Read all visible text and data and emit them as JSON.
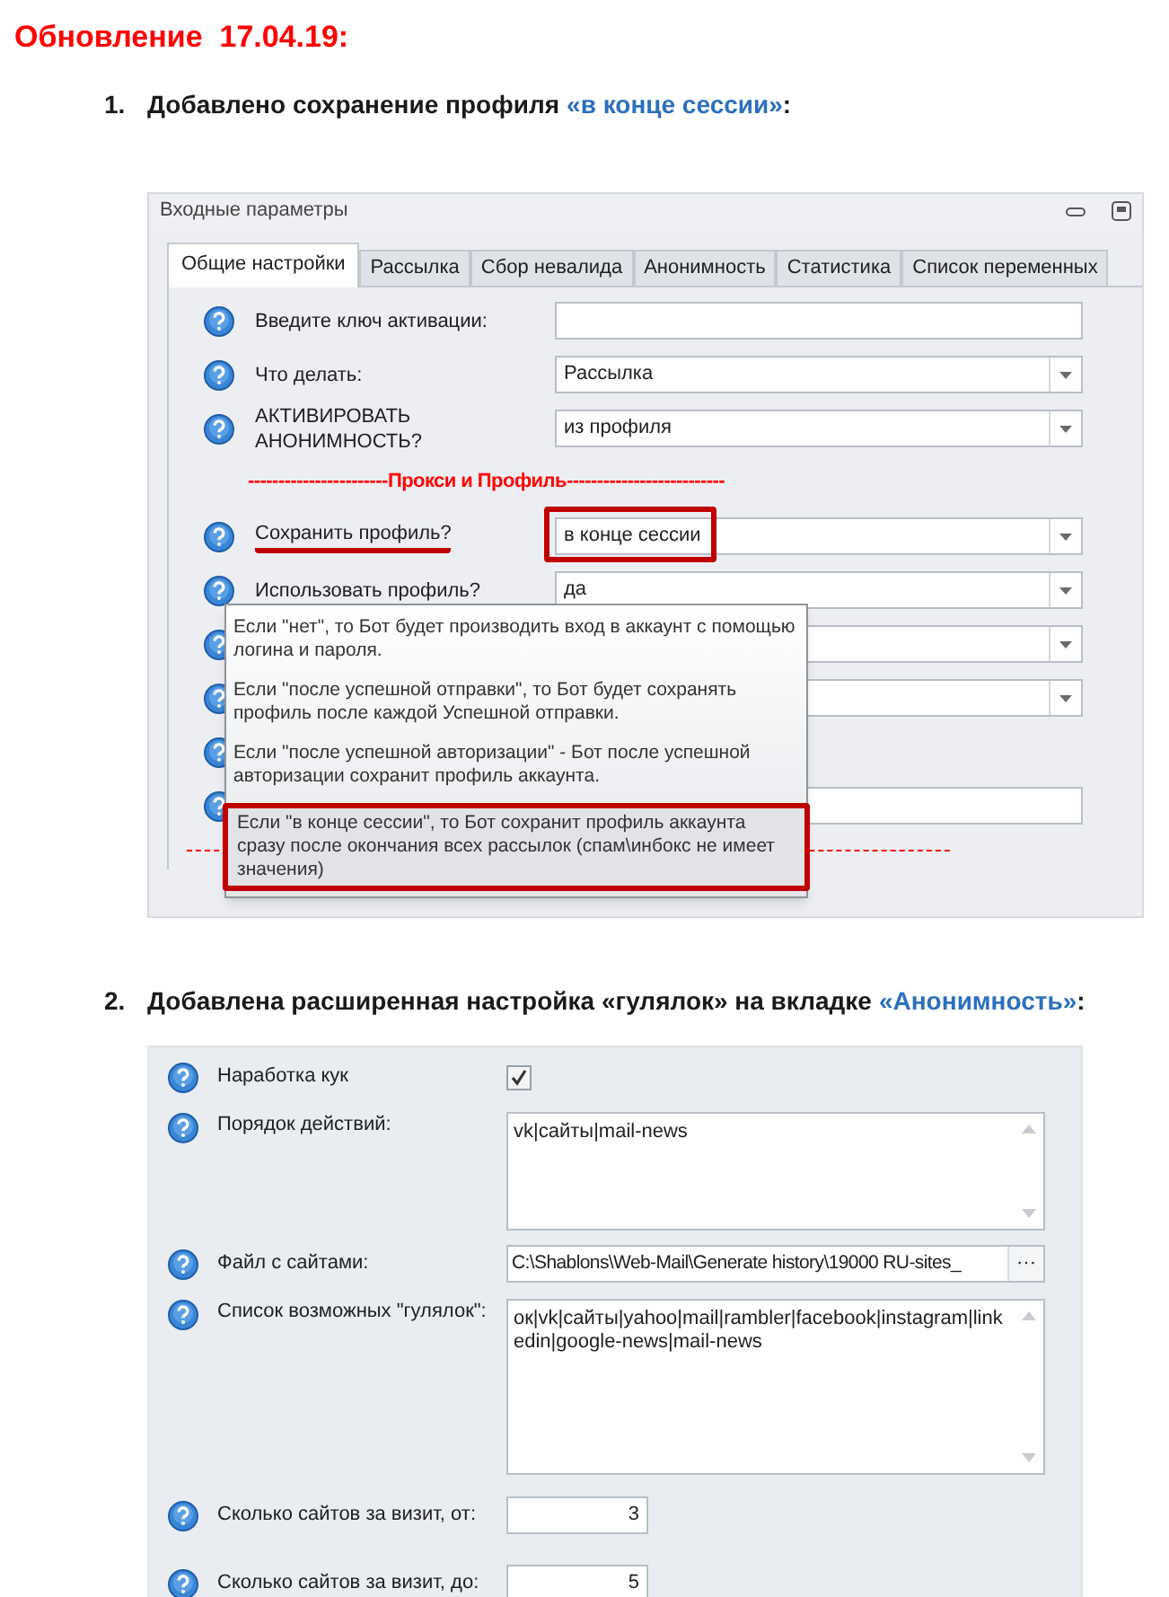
{
  "heading": "Обновление  17.04.19:",
  "items": [
    {
      "number": "1.",
      "text": "Добавлено сохранение профиля",
      "highlight": "«в конце сессии»",
      "suffix": ":",
      "panel": {
        "title": "Входные параметры",
        "tabs": [
          {
            "label": "Общие настройки",
            "selected": true
          },
          {
            "label": "Рассылка",
            "selected": false
          },
          {
            "label": "Сбор невалида",
            "selected": false
          },
          {
            "label": "Анонимность",
            "selected": false
          },
          {
            "label": "Статистика",
            "selected": false
          },
          {
            "label": "Список переменных",
            "selected": false
          }
        ],
        "rows": [
          {
            "kind": "input",
            "label": "Введите ключ активации:"
          },
          {
            "kind": "select",
            "label": "Что делать:",
            "value": "Рассылка"
          },
          {
            "kind": "select",
            "label": "АКТИВИРОВАТЬ АНОНИМНОСТЬ?",
            "value": "из профиля"
          },
          {
            "kind": "separator",
            "label": "Прокси и Профиль",
            "left": "-----------------------",
            "right": "--------------------------"
          },
          {
            "kind": "select",
            "label": "Сохранить профиль?",
            "value": "в конце сессии",
            "marked": true
          },
          {
            "kind": "select",
            "label": "Использовать профиль?",
            "value": "да"
          },
          {
            "kind": "select"
          },
          {
            "kind": "select"
          },
          {
            "kind": "blank"
          },
          {
            "kind": "input"
          },
          {
            "kind": "dashes"
          }
        ],
        "tooltip": [
          {
            "text": "Если \"нет\", то Бот будет производить вход в аккаунт с помощью логина и пароля.",
            "selected": false
          },
          {
            "text": "Если \"после успешной отправки\", то Бот будет сохранять профиль после каждой Успешной отправки.",
            "selected": false
          },
          {
            "text": "Если \"после успешной авторизации\" - Бот после успешной авторизации сохранит профиль аккаунта.",
            "selected": false
          },
          {
            "text": "Если \"в конце сессии\", то Бот сохранит профиль аккаунта сразу после окончания всех рассылок (спам\\инбокс не имеет значения)",
            "selected": true
          }
        ]
      }
    },
    {
      "number": "2.",
      "text": "Добавлена расширенная настройка «гулялок» на вкладке",
      "highlight": "«Анонимность»",
      "suffix": ":",
      "panel": {
        "rows": [
          {
            "kind": "checkbox",
            "label": "Наработка кук",
            "checked": true
          },
          {
            "kind": "textarea",
            "label": "Порядок действий:",
            "value": "vk|сайты|mail-news"
          },
          {
            "kind": "file",
            "label": "Файл с сайтами:",
            "value": "C:\\Shablons\\Web-Mail\\Generate history\\19000 RU-sites_",
            "button": "···"
          },
          {
            "kind": "textlist",
            "label": "Список возможных \"гулялок\":",
            "value": "ок|vk|сайты|yahoo|mail|rambler|facebook|instagram|linkedin|google-news|mail-news"
          },
          {
            "kind": "number",
            "label": "Сколько сайтов за визит, от:",
            "value": "3"
          },
          {
            "kind": "number",
            "label": "Сколько сайтов за визит, до:",
            "value": "5"
          }
        ]
      }
    }
  ]
}
